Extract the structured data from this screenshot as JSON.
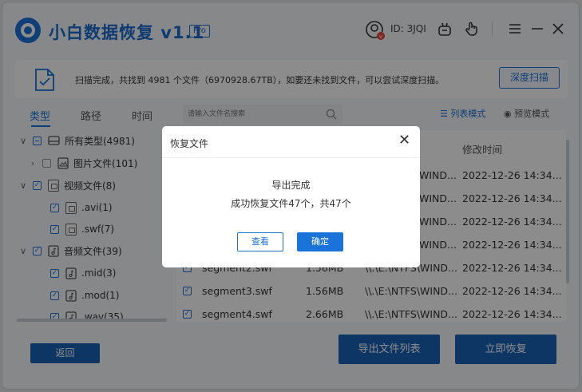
{
  "app": {
    "title": "小白数据恢复 v1.1",
    "pro_badge": "Pro",
    "user_id": "ID: 3JQI"
  },
  "infobar": {
    "message": "扫描完成，共找到 4981 个文件（6970928.67TB），如要还未找到文件，可以尝试深度扫描。",
    "deep_scan_label": "深度扫描"
  },
  "tabs": [
    {
      "label": "类型",
      "active": true
    },
    {
      "label": "路径",
      "active": false
    },
    {
      "label": "时间",
      "active": false
    }
  ],
  "tree": [
    {
      "label": "所有类型(4981)",
      "level": 0,
      "expanded": true,
      "check": "partial"
    },
    {
      "label": "图片文件(101)",
      "level": 1,
      "expanded": false,
      "check": "empty"
    },
    {
      "label": "视频文件(8)",
      "level": 1,
      "expanded": true,
      "check": "checked"
    },
    {
      "label": ".avi(1)",
      "level": 2,
      "check": "checked"
    },
    {
      "label": ".swf(7)",
      "level": 2,
      "check": "checked"
    },
    {
      "label": "音频文件(39)",
      "level": 1,
      "expanded": true,
      "check": "checked"
    },
    {
      "label": ".mid(3)",
      "level": 2,
      "check": "checked"
    },
    {
      "label": ".mod(1)",
      "level": 2,
      "check": "checked"
    },
    {
      "label": ".wav(35)",
      "level": 2,
      "check": "checked"
    }
  ],
  "search": {
    "placeholder": "请输入文件名搜索"
  },
  "view_modes": {
    "list": "列表模式",
    "preview": "预览模式"
  },
  "table": {
    "columns": {
      "modified": "修改时间"
    },
    "rows": [
      {
        "name": "",
        "size": "",
        "path": "WIND...",
        "modified": "2022-12-26 14:34..."
      },
      {
        "name": "",
        "size": "",
        "path": "WIND...",
        "modified": "2022-12-26 14:34..."
      },
      {
        "name": "",
        "size": "",
        "path": "WIND...",
        "modified": "2022-12-26 14:34..."
      },
      {
        "name": "",
        "size": "",
        "path": "WIND...",
        "modified": "2022-12-26 14:34..."
      },
      {
        "name": "segment2.swf",
        "size": "1.56MB",
        "path": "\\\\.\\E:\\NTFS\\WIND...",
        "modified": "2022-12-26 14:34..."
      },
      {
        "name": "segment3.swf",
        "size": "1.56MB",
        "path": "\\\\.\\E:\\NTFS\\WIND...",
        "modified": "2022-12-26 14:34..."
      },
      {
        "name": "segment4.swf",
        "size": "2.66MB",
        "path": "\\\\.\\E:\\NTFS\\WIND...",
        "modified": "2022-12-26 14:34..."
      }
    ]
  },
  "buttons": {
    "back": "返回",
    "export_list": "导出文件列表",
    "recover_now": "立即恢复"
  },
  "dialog": {
    "title": "恢复文件",
    "line1": "导出完成",
    "line2": "成功恢复文件47个，共47个",
    "view_label": "查看",
    "ok_label": "确定"
  },
  "colors": {
    "accent": "#1a73d9",
    "button_dark": "#1a63b8"
  }
}
